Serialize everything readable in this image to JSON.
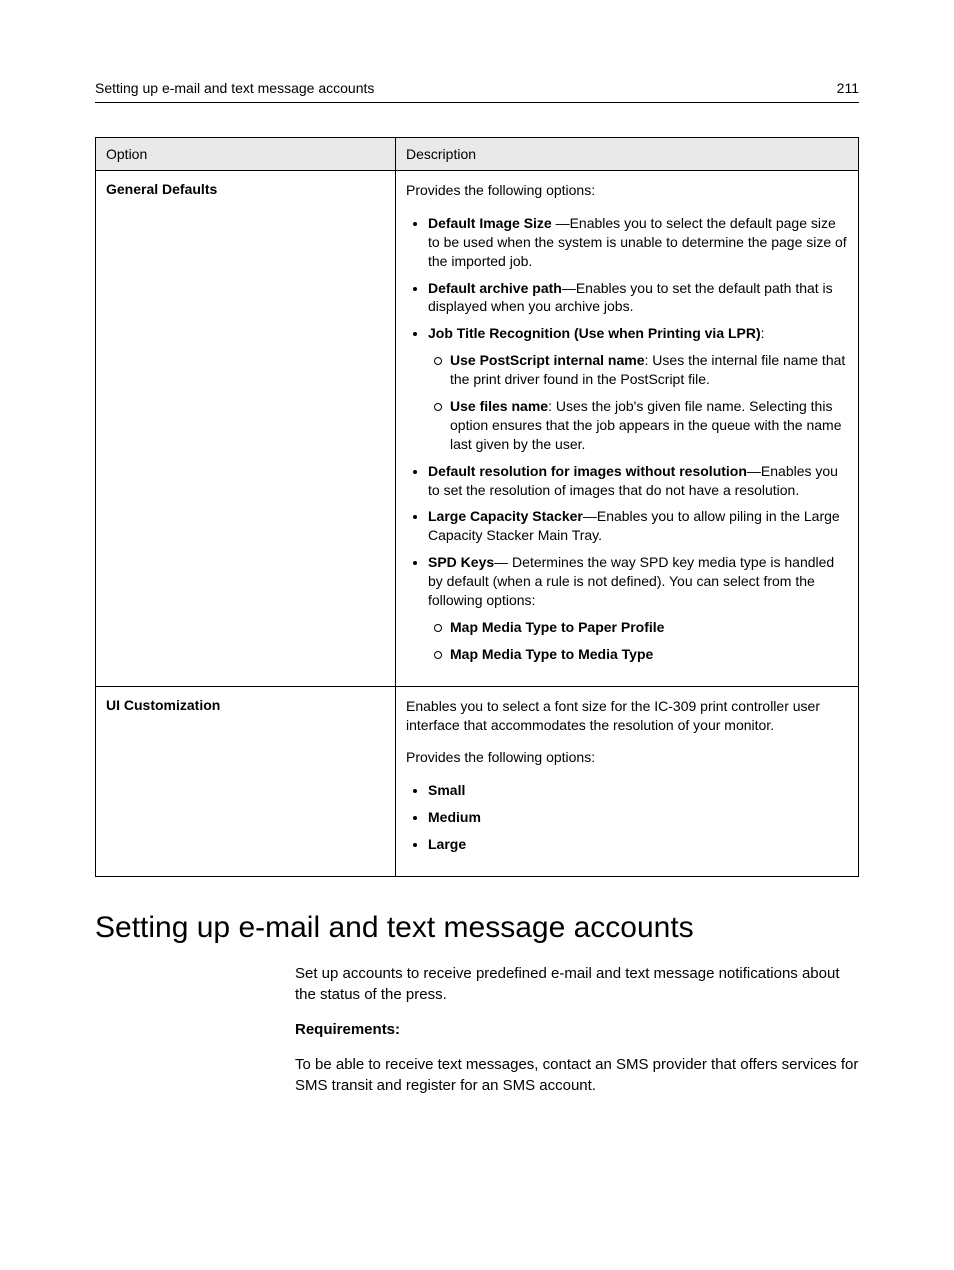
{
  "header": {
    "left": "Setting up e-mail and text message accounts",
    "right": "211"
  },
  "table": {
    "col1_header": "Option",
    "col2_header": "Description",
    "row1": {
      "option": "General Defaults",
      "intro": "Provides the following options:",
      "items": {
        "img_size_b": "Default Image Size ",
        "img_size_t": "—Enables you to select the default page size to be used when the system is unable to determine the page size of the imported job.",
        "arch_b": "Default archive path",
        "arch_t": "—Enables you to set the default path that is displayed when you archive jobs.",
        "jtr_b": "Job Title Recognition (Use when Printing via LPR)",
        "jtr_t": ":",
        "jtr_sub1_b": "Use PostScript internal name",
        "jtr_sub1_t": ": Uses the internal file name that the print driver found in the PostScript file.",
        "jtr_sub2_b": "Use files name",
        "jtr_sub2_t": ": Uses the job's given file name. Selecting this option ensures that the job appears in the queue with the name last given by the user.",
        "res_b": "Default resolution for images without resolution",
        "res_t": "—Enables you to set the resolution of images that do not have a resolution.",
        "lcs_b": "Large Capacity Stacker",
        "lcs_t": "—Enables you to allow piling in the Large Capacity Stacker Main Tray.",
        "spd_b": "SPD Keys",
        "spd_t": "— Determines the way SPD key media type is handled by default (when a rule is not defined). You can select from the following options:",
        "spd_sub1": "Map Media Type to Paper Profile",
        "spd_sub2": "Map Media Type to Media Type"
      }
    },
    "row2": {
      "option": "UI Customization",
      "p1": "Enables you to select a font size for the IC-309 print controller user interface that accommodates the resolution of your monitor.",
      "p2": "Provides the following options:",
      "items": {
        "small": "Small",
        "medium": "Medium",
        "large": "Large"
      }
    }
  },
  "section": {
    "title": "Setting up e-mail and text message accounts",
    "p1": "Set up accounts to receive predefined e-mail and text message notifications about the status of the press.",
    "req": "Requirements:",
    "p2": "To be able to receive text messages, contact an SMS provider that offers services for SMS transit and register for an SMS account."
  }
}
